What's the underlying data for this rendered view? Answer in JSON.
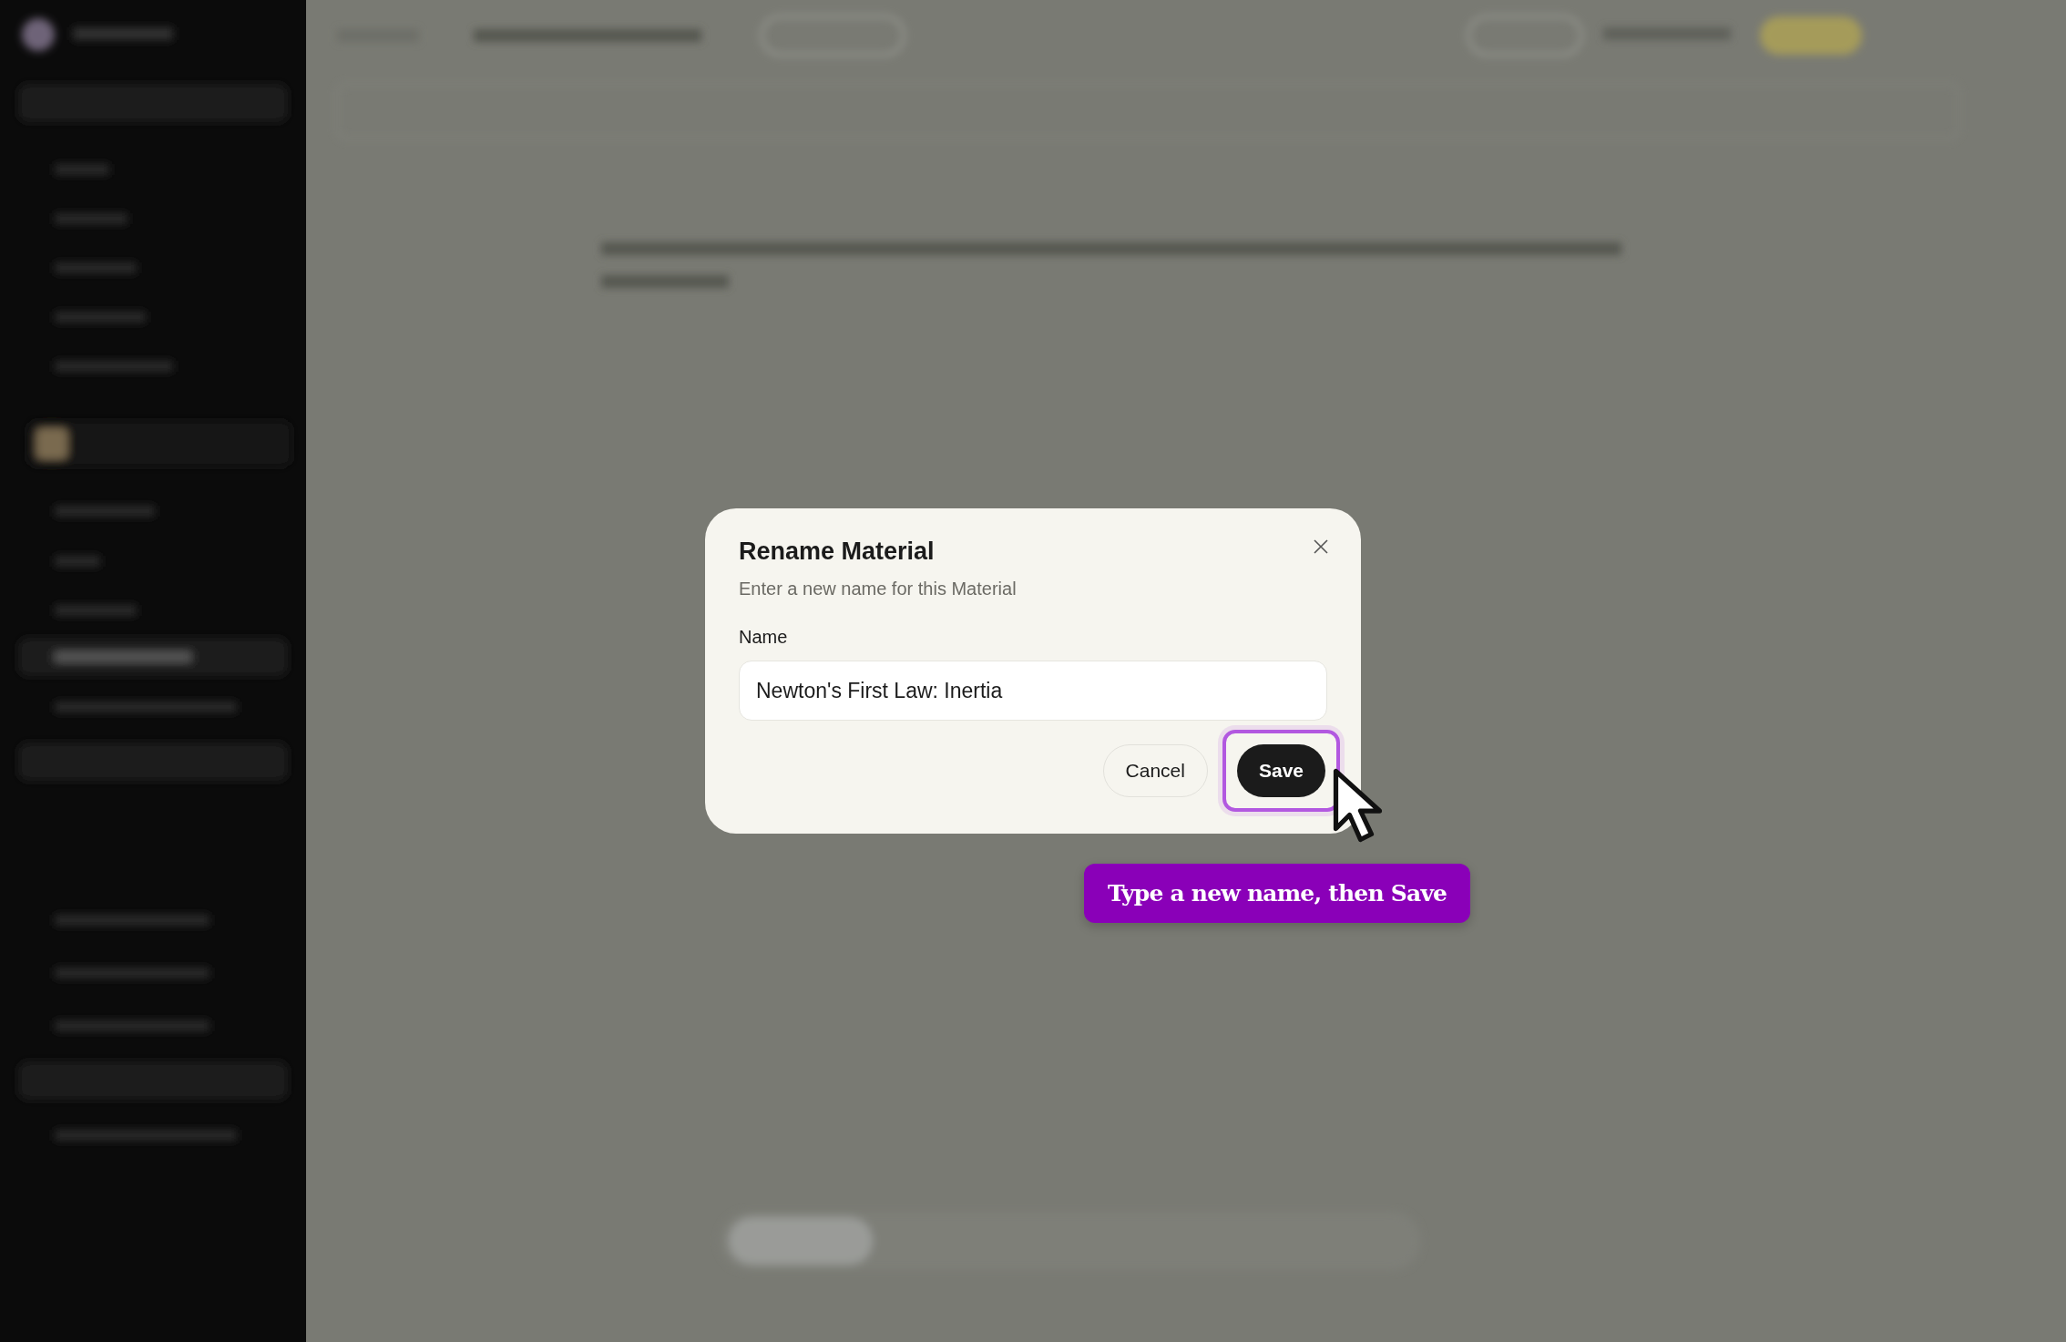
{
  "dialog": {
    "title": "Rename Material",
    "description": "Enter a new name for this Material",
    "field": {
      "label": "Name",
      "value": "Newton's First Law: Inertia"
    },
    "buttons": [
      {
        "label": "Cancel",
        "kind": "secondary",
        "highlighted": false
      },
      {
        "label": "Save",
        "kind": "primary",
        "highlighted": true
      }
    ]
  },
  "tooltip": {
    "text": "Type a new name, then Save"
  }
}
